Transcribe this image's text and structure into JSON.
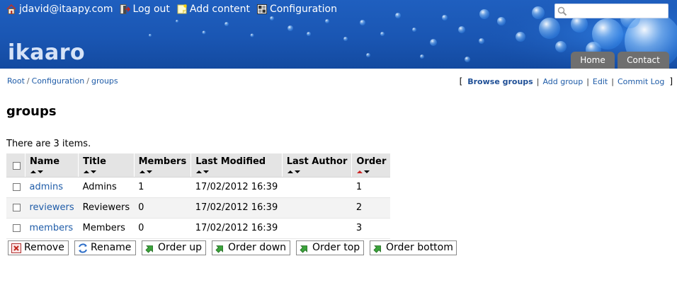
{
  "header": {
    "user_link": "jdavid@itaapy.com",
    "logout_link": "Log out",
    "add_content_link": "Add content",
    "configuration_link": "Configuration",
    "logo_text": "ikaaro",
    "search_placeholder": "",
    "tabs": [
      "Home",
      "Contact"
    ],
    "icons": [
      "home-icon",
      "logout-icon",
      "note-icon",
      "configuration-icon",
      "search-icon"
    ]
  },
  "breadcrumb": {
    "items": [
      "Root",
      "Configuration",
      "groups"
    ],
    "separator": "/"
  },
  "actions": {
    "open": "[",
    "close": "]",
    "separator": "|",
    "items": [
      "Browse groups",
      "Add group",
      "Edit",
      "Commit Log"
    ]
  },
  "page": {
    "title": "groups",
    "item_count": "There are 3 items."
  },
  "table": {
    "columns": [
      "Name",
      "Title",
      "Members",
      "Last Modified",
      "Last Author",
      "Order"
    ],
    "rows": [
      {
        "name": "admins",
        "title": "Admins",
        "members": "1",
        "last_modified": "17/02/2012 16:39",
        "last_author": "",
        "order": "1"
      },
      {
        "name": "reviewers",
        "title": "Reviewers",
        "members": "0",
        "last_modified": "17/02/2012 16:39",
        "last_author": "",
        "order": "2"
      },
      {
        "name": "members",
        "title": "Members",
        "members": "0",
        "last_modified": "17/02/2012 16:39",
        "last_author": "",
        "order": "3"
      }
    ],
    "sorted_column": "Order"
  },
  "buttons": [
    "Remove",
    "Rename",
    "Order up",
    "Order down",
    "Order top",
    "Order bottom"
  ],
  "colors": {
    "header_blue": "#1a56b3",
    "link": "#1f5ca8",
    "tab_gray": "#6f6f6f",
    "table_header": "#e4e4e4",
    "sort_active": "#cc2222"
  }
}
